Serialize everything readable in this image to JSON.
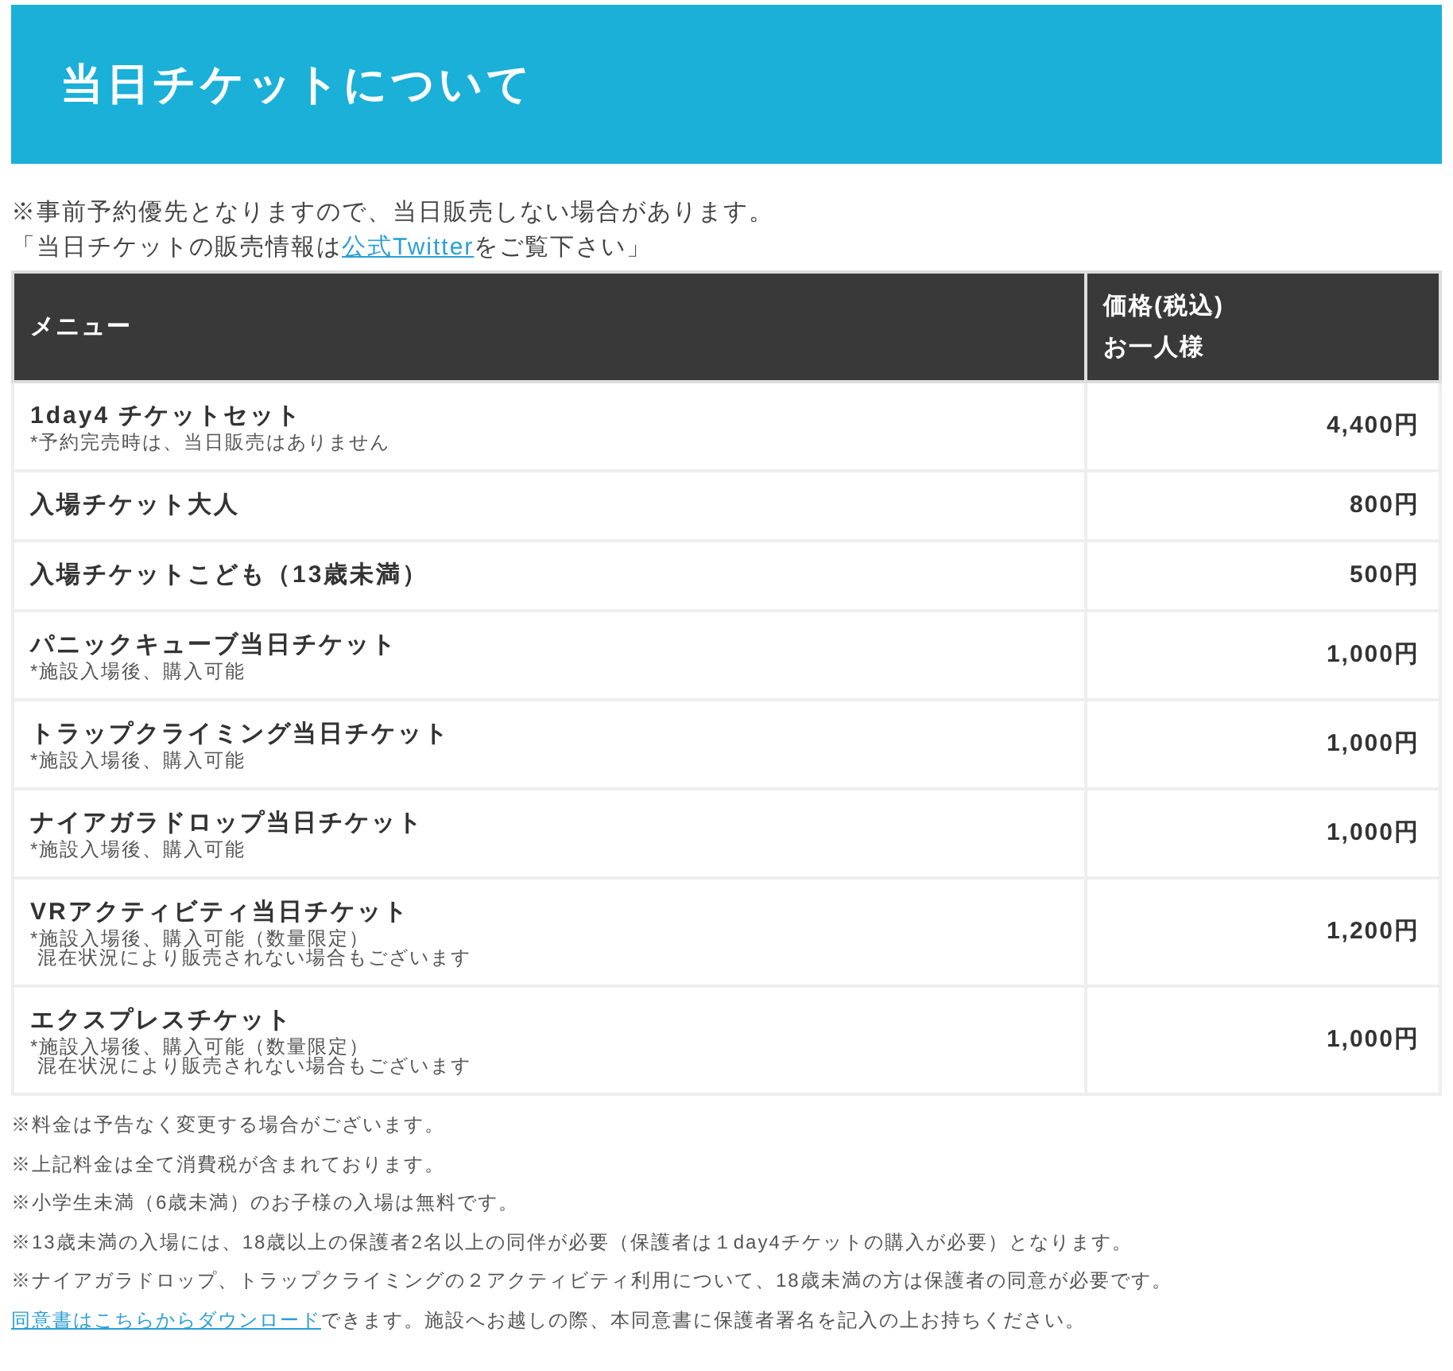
{
  "header": {
    "title": "当日チケットについて"
  },
  "intro": {
    "notice": "※事前予約優先となりますので、当日販売しない場合があります。",
    "before": "「当日チケットの販売情報は",
    "link": "公式Twitter",
    "after": "をご覧下さい」"
  },
  "table": {
    "columns": [
      {
        "lines": [
          "メニュー"
        ]
      },
      {
        "lines": [
          "価格(税込)",
          "お一人様"
        ]
      }
    ],
    "rows": [
      {
        "name": "1day4 チケットセット",
        "notes": [
          "*予約完売時は、当日販売はありません"
        ],
        "price": "4,400円"
      },
      {
        "name": "入場チケット大人",
        "notes": [],
        "price": "800円"
      },
      {
        "name": "入場チケットこども（13歳未満）",
        "notes": [],
        "price": "500円"
      },
      {
        "name": "パニックキューブ当日チケット",
        "notes": [
          "*施設入場後、購入可能"
        ],
        "price": "1,000円"
      },
      {
        "name": "トラップクライミング当日チケット",
        "notes": [
          "*施設入場後、購入可能"
        ],
        "price": "1,000円"
      },
      {
        "name": "ナイアガラドロップ当日チケット",
        "notes": [
          "*施設入場後、購入可能"
        ],
        "price": "1,000円"
      },
      {
        "name": "VRアクティビティ当日チケット",
        "notes": [
          "*施設入場後、購入可能（数量限定）",
          " 混在状況により販売されない場合もございます"
        ],
        "price": "1,200円"
      },
      {
        "name": "エクスプレスチケット",
        "notes": [
          "*施設入場後、購入可能（数量限定）",
          " 混在状況により販売されない場合もございます"
        ],
        "price": "1,000円"
      }
    ]
  },
  "footnotes": [
    {
      "text": "※料金は予告なく変更する場合がございます。"
    },
    {
      "text": "※上記料金は全て消費税が含まれております。"
    },
    {
      "text": "※小学生未満（6歳未満）のお子様の入場は無料です。"
    },
    {
      "text": "※13歳未満の入場には、18歳以上の保護者2名以上の同伴が必要（保護者は１day4チケットの購入が必要）となります。"
    },
    {
      "text": "※ナイアガラドロップ、トラップクライミングの２アクティビティ利用について、18歳未満の方は保護者の同意が必要です。",
      "link": "同意書はこちらからダウンロード",
      "after": "できます。施設へお越しの際、本同意書に保護者署名を記入の上お持ちください。"
    }
  ]
}
